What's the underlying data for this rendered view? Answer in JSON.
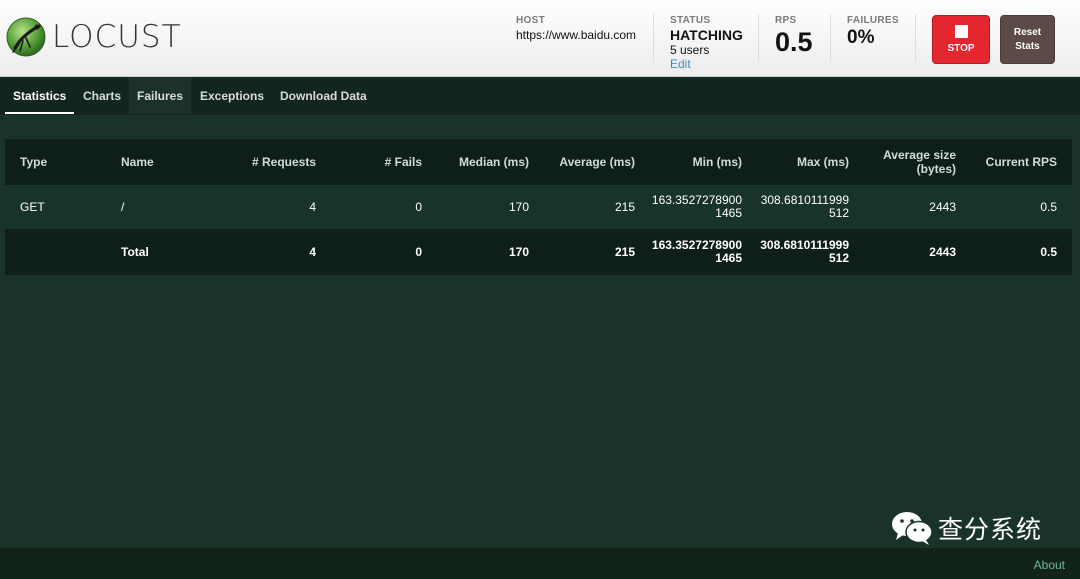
{
  "app": {
    "logo_text": "LOCUST"
  },
  "stats": {
    "host": {
      "label": "HOST",
      "value": "https://www.baidu.com"
    },
    "status": {
      "label": "STATUS",
      "value": "HATCHING",
      "users": "5 users",
      "edit_label": "Edit"
    },
    "rps": {
      "label": "RPS",
      "value": "0.5"
    },
    "failures": {
      "label": "FAILURES",
      "value": "0%"
    }
  },
  "buttons": {
    "stop_label": "STOP",
    "reset_label_line1": "Reset",
    "reset_label_line2": "Stats"
  },
  "tabs": [
    {
      "label": "Statistics",
      "active": true
    },
    {
      "label": "Charts",
      "active": false
    },
    {
      "label": "Failures",
      "active": false
    },
    {
      "label": "Exceptions",
      "active": false
    },
    {
      "label": "Download Data",
      "active": false
    }
  ],
  "table": {
    "headers": [
      "Type",
      "Name",
      "# Requests",
      "# Fails",
      "Median (ms)",
      "Average (ms)",
      "Min (ms)",
      "Max (ms)",
      "Average size (bytes)",
      "Current RPS"
    ],
    "rows": [
      {
        "type": "GET",
        "name": "/",
        "requests": "4",
        "fails": "0",
        "median": "170",
        "average": "215",
        "min_l1": "163.3527278900",
        "min_l2": "1465",
        "max_l1": "308.6810111999",
        "max_l2": "512",
        "avg_size": "2443",
        "current_rps": "0.5"
      }
    ],
    "total": {
      "type": "",
      "name": "Total",
      "requests": "4",
      "fails": "0",
      "median": "170",
      "average": "215",
      "min_l1": "163.3527278900",
      "min_l2": "1465",
      "max_l1": "308.6810111999",
      "max_l2": "512",
      "avg_size": "2443",
      "current_rps": "0.5"
    }
  },
  "footer": {
    "about_label": "About"
  },
  "watermark": {
    "text": "查分系统",
    "icon": "wechat-icon"
  }
}
